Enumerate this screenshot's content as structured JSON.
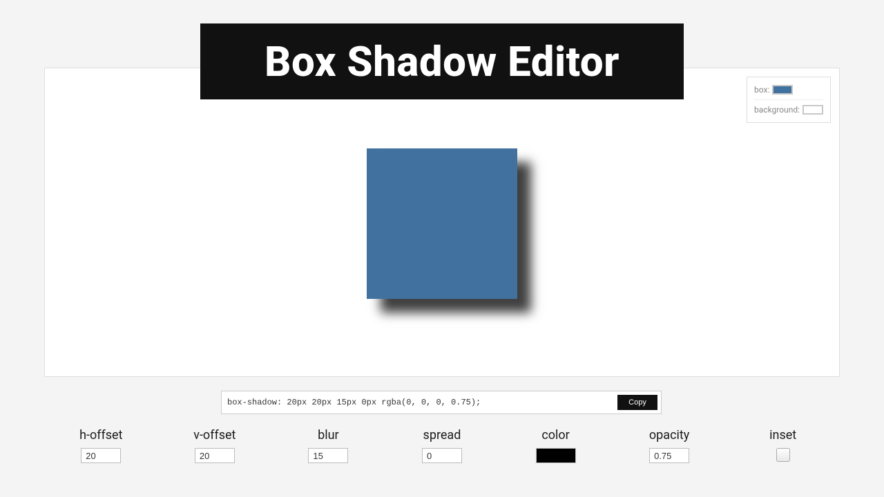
{
  "title": "Box Shadow Editor",
  "colorPanel": {
    "boxLabel": "box:",
    "boxColor": "#41729f",
    "bgLabel": "background:",
    "bgColor": "#ffffff"
  },
  "preview": {
    "boxColor": "#41729f",
    "shadow": "20px 20px 15px 0px rgba(0,0,0,0.75)"
  },
  "output": {
    "css": "box-shadow: 20px 20px 15px 0px rgba(0, 0, 0, 0.75);",
    "copyLabel": "Copy"
  },
  "controls": {
    "hOffset": {
      "label": "h-offset",
      "value": "20"
    },
    "vOffset": {
      "label": "v-offset",
      "value": "20"
    },
    "blur": {
      "label": "blur",
      "value": "15"
    },
    "spread": {
      "label": "spread",
      "value": "0"
    },
    "color": {
      "label": "color",
      "value": "#000000"
    },
    "opacity": {
      "label": "opacity",
      "value": "0.75"
    },
    "inset": {
      "label": "inset",
      "checked": false
    }
  }
}
